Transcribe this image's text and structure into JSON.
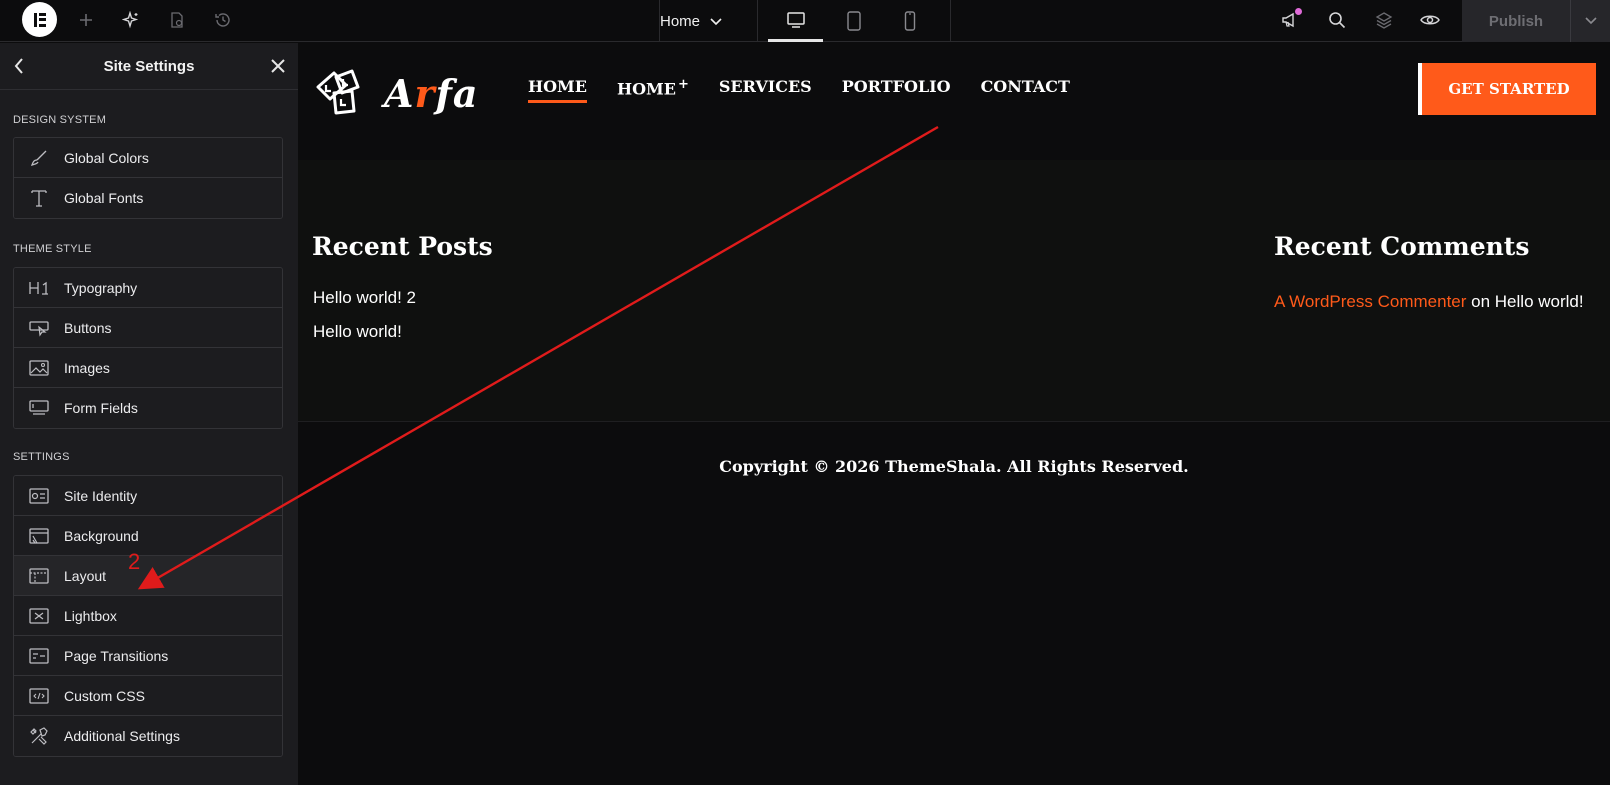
{
  "topbar": {
    "page_name": "Home",
    "publish_label": "Publish",
    "icons": [
      "elementor-logo-icon",
      "add-icon",
      "ai-sparkle-icon",
      "page-settings-icon",
      "history-icon",
      "chevron-down-icon",
      "desktop-icon",
      "tablet-icon",
      "mobile-icon",
      "whats-new-icon",
      "search-icon",
      "structure-icon",
      "preview-icon"
    ]
  },
  "sidebar": {
    "title": "Site Settings",
    "sections": [
      {
        "title": "DESIGN SYSTEM",
        "items": [
          {
            "label": "Global Colors",
            "icon": "brush-icon"
          },
          {
            "label": "Global Fonts",
            "icon": "type-icon"
          }
        ]
      },
      {
        "title": "THEME STYLE",
        "items": [
          {
            "label": "Typography",
            "icon": "heading-icon"
          },
          {
            "label": "Buttons",
            "icon": "button-icon"
          },
          {
            "label": "Images",
            "icon": "image-icon"
          },
          {
            "label": "Form Fields",
            "icon": "form-field-icon"
          }
        ]
      },
      {
        "title": "SETTINGS",
        "items": [
          {
            "label": "Site Identity",
            "icon": "site-identity-icon"
          },
          {
            "label": "Background",
            "icon": "background-icon"
          },
          {
            "label": "Layout",
            "icon": "layout-icon"
          },
          {
            "label": "Lightbox",
            "icon": "lightbox-icon"
          },
          {
            "label": "Page Transitions",
            "icon": "page-transitions-icon"
          },
          {
            "label": "Custom CSS",
            "icon": "code-icon"
          },
          {
            "label": "Additional Settings",
            "icon": "tools-icon"
          }
        ]
      }
    ]
  },
  "site": {
    "brand_prefix": "A",
    "brand_accent": "r",
    "brand_suffix": "fa",
    "nav": [
      "HOME",
      "HOME",
      "SERVICES",
      "PORTFOLIO",
      "CONTACT"
    ],
    "nav_plus": "+",
    "cta": "GET STARTED",
    "recent_posts": {
      "title": "Recent Posts",
      "posts": [
        "Hello world! 2",
        "Hello world!"
      ]
    },
    "recent_comments": {
      "title": "Recent Comments",
      "author": "A WordPress Commenter",
      "on_text": " on ",
      "post": "Hello world!"
    },
    "copyright": "Copyright © 2026 ThemeShala. All Rights Reserved."
  },
  "annotation": {
    "number": "2",
    "color": "#e01b1b"
  },
  "colors": {
    "accent": "#ff5a1a",
    "sidebar_bg": "#1c1c1f",
    "canvas_bg": "#0c0c0d"
  }
}
